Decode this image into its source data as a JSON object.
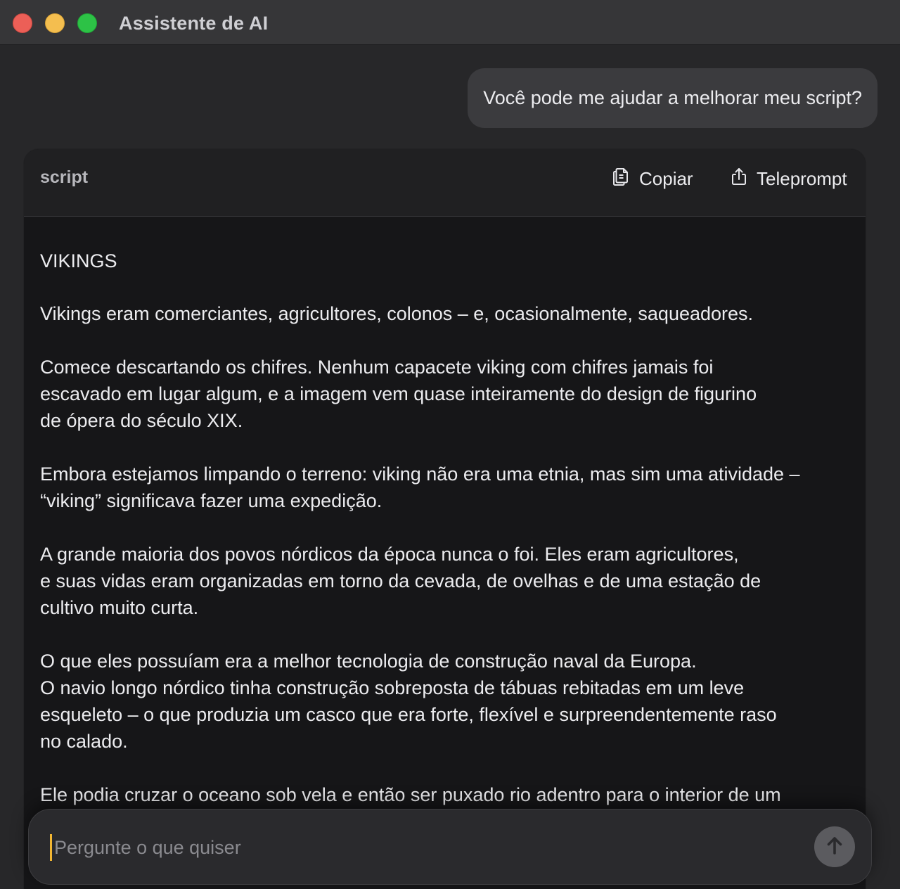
{
  "window": {
    "title": "Assistente de AI"
  },
  "chat": {
    "user_message": "Você pode me ajudar a melhorar meu script?"
  },
  "card": {
    "label": "script",
    "copy_label": "Copiar",
    "teleprompt_label": "Teleprompt",
    "heading": "VIKINGS",
    "paragraphs": [
      "Vikings eram comerciantes, agricultores, colonos – e, ocasionalmente, saqueadores.",
      "Comece descartando os chifres. Nenhum capacete viking com chifres jamais foi\nescavado em lugar algum, e a imagem vem quase inteiramente do design de figurino\nde ópera do século XIX.",
      "Embora estejamos limpando o terreno: viking não era uma etnia, mas sim uma atividade –\n“viking” significava fazer uma expedição.",
      "A grande maioria dos povos nórdicos da época nunca o foi. Eles eram agricultores,\ne suas vidas eram organizadas em torno da cevada, de ovelhas e de uma estação de\ncultivo muito curta.",
      "O que eles possuíam era a melhor tecnologia de construção naval da Europa.\nO navio longo nórdico tinha construção sobreposta de tábuas rebitadas em um leve\nesqueleto – o que produzia um casco que era forte, flexível e surpreendentemente raso\nno calado.",
      "Ele podia cruzar o oceano sob vela e então ser puxado rio adentro para o interior de um"
    ]
  },
  "composer": {
    "placeholder": "Pergunte o que quiser",
    "value": ""
  },
  "colors": {
    "background": "#272729",
    "titlebar": "#363638",
    "card": "#161618",
    "caret": "#f2b632"
  },
  "icons": {
    "copy": "copy-icon",
    "teleprompt": "share-icon",
    "send": "arrow-up-icon"
  }
}
